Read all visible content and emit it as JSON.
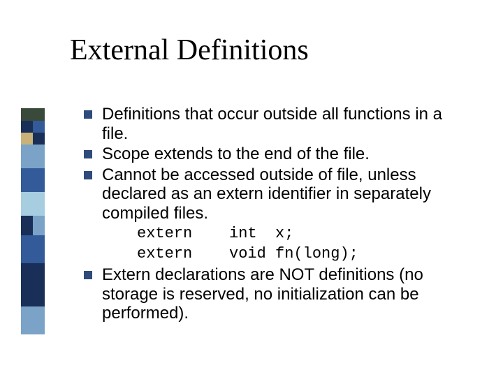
{
  "title": "External Definitions",
  "bullets": [
    "Definitions that occur outside all functions in a file.",
    "Scope extends to the end of the file.",
    "Cannot be accessed outside of file, unless declared as an extern identifier in separately compiled files.",
    "Extern declarations are NOT definitions (no storage is reserved, no initialization can be performed)."
  ],
  "code": [
    "extern    int  x;",
    "extern    void fn(long);"
  ],
  "colors": {
    "bullet": "#2f4b7c"
  }
}
